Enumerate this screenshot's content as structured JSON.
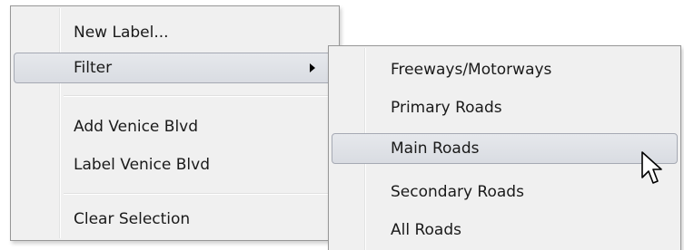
{
  "context_menu": {
    "items": [
      {
        "label": "New Label..."
      },
      {
        "label": "Filter"
      },
      {
        "label": "Add Venice Blvd"
      },
      {
        "label": "Label Venice Blvd"
      },
      {
        "label": "Clear Selection"
      }
    ],
    "icons": {
      "submenu_arrow": "chevron-right-icon"
    }
  },
  "filter_submenu": {
    "items": [
      {
        "label": "Freeways/Motorways"
      },
      {
        "label": "Primary Roads"
      },
      {
        "label": "Main Roads"
      },
      {
        "label": "Secondary Roads"
      },
      {
        "label": "All Roads"
      }
    ]
  },
  "cursor": {
    "icon": "mouse-pointer-icon"
  },
  "colors": {
    "menu_background": "#f0f0f0",
    "menu_border": "#979797",
    "highlight_border": "#a5a9b3"
  }
}
